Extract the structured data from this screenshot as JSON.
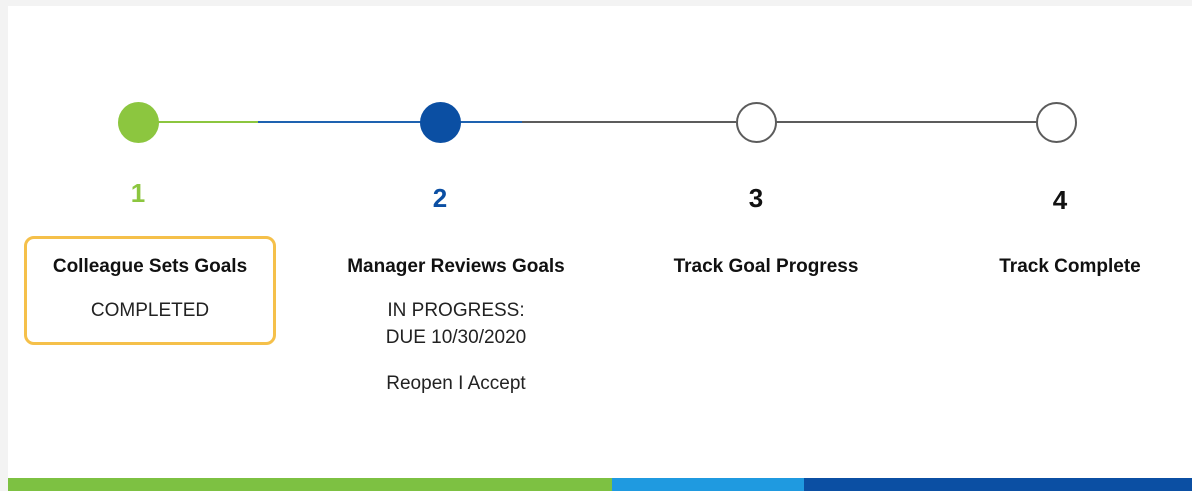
{
  "colors": {
    "completed": "#8cc63f",
    "in_progress": "#0b4fa3",
    "pending_line": "#5c5c5c",
    "highlight_border": "#f5c04a",
    "bar_green": "#7dc142",
    "bar_light_blue": "#1f9ae0",
    "bar_dark_blue": "#0b4fa3"
  },
  "steps": [
    {
      "number": "1",
      "title": "Colleague Sets Goals",
      "status": "COMPLETED",
      "state": "completed"
    },
    {
      "number": "2",
      "title": "Manager Reviews Goals",
      "status": "IN PROGRESS: DUE 10/30/2020",
      "state": "in-progress",
      "actions": {
        "reopen": "Reopen",
        "separator": "I",
        "accept": "Accept"
      }
    },
    {
      "number": "3",
      "title": "Track Goal Progress",
      "state": "pending"
    },
    {
      "number": "4",
      "title": "Track Complete",
      "state": "pending"
    }
  ]
}
